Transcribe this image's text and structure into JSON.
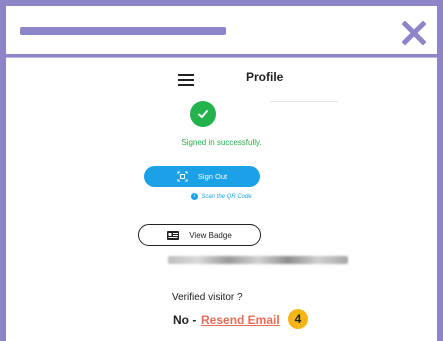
{
  "window": {
    "close_icon": "close-icon"
  },
  "header": {
    "menu_icon": "hamburger-menu-icon",
    "title": "Profile"
  },
  "status": {
    "icon": "check-circle-icon",
    "message": "Signed in successfully."
  },
  "sign_out": {
    "label": "Sign Out",
    "icon": "qr-code-icon",
    "hint": "Scan the QR Code",
    "hint_icon": "info-icon"
  },
  "badge": {
    "label": "View Badge",
    "icon": "id-card-icon"
  },
  "verification": {
    "question": "Verified visitor ?",
    "status_label": "No -",
    "resend_label": "Resend Email",
    "step_number": "4"
  },
  "colors": {
    "frame": "#8c86c8",
    "success": "#23b24b",
    "primary": "#1aa1e6",
    "link": "#e36d57",
    "step_badge": "#f4b41a"
  }
}
